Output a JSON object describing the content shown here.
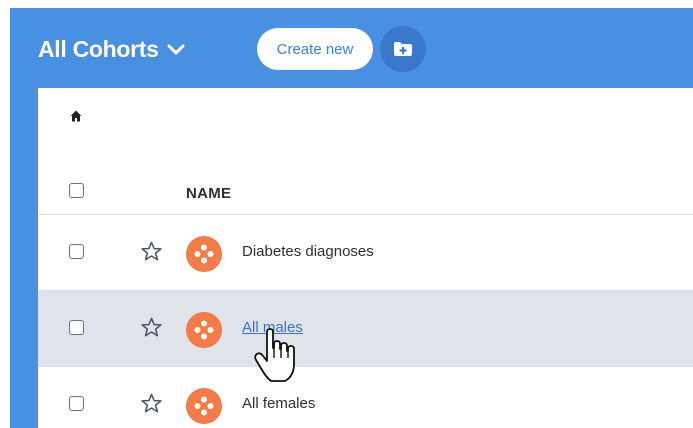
{
  "header": {
    "title": "All Cohorts",
    "create_label": "Create new"
  },
  "icons": {
    "title_dropdown": "chevron-down-icon",
    "new_folder": "folder-plus-icon",
    "home": "home-icon",
    "favorite": "star-icon",
    "cohort": "cohort-icon",
    "cursor": "hand-pointer-cursor"
  },
  "table": {
    "columns": [
      "NAME"
    ],
    "rows": [
      {
        "name": "Diabetes diagnoses",
        "hovered": false
      },
      {
        "name": "All males",
        "hovered": true
      },
      {
        "name": "All females",
        "hovered": false
      }
    ]
  },
  "colors": {
    "header_bg": "#4a90e2",
    "accent": "#3f7fd6",
    "cohort_icon": "#f47c4a",
    "row_hover": "#dfe3ea",
    "link": "#3f6fd0"
  }
}
